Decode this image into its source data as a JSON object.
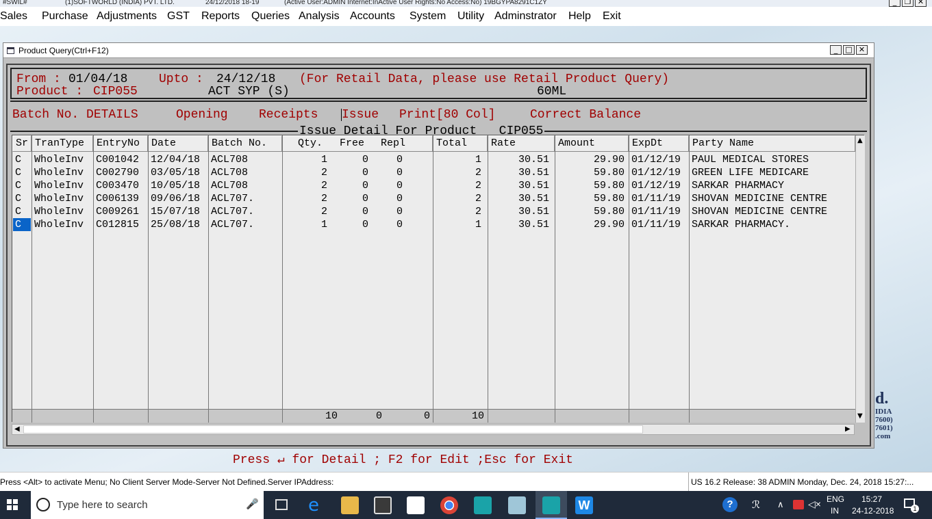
{
  "titlebar": {
    "app": "#SWIL#",
    "company": "(1)SOFTWORLD (INDIA) PVT. LTD.",
    "datetime": "24/12/2018 18-19",
    "status": "(Active User:ADMIN Internet:InActive User Rights:No Access:No) 19BGYPA8291C1ZY"
  },
  "menu": [
    "Sales",
    "Purchase",
    "Adjustments",
    "GST",
    "Reports",
    "Queries",
    "Analysis",
    "Accounts",
    "System",
    "Utility",
    "Adminstrator",
    "Help",
    "Exit"
  ],
  "window": {
    "title": "Product Query(Ctrl+F12)"
  },
  "header": {
    "from_label": "From :",
    "from_value": "01/04/18",
    "upto_label": "Upto :",
    "upto_value": "24/12/18",
    "retail_note": "(For Retail Data, please use Retail Product Query)",
    "product_label": "Product :",
    "product_code": "CIP055",
    "product_name": "ACT SYP (S)",
    "pack": "60ML"
  },
  "options": [
    "Batch No. DETAILS",
    "Opening",
    "Receipts",
    "Issue",
    "Print[80 Col]",
    "Correct Balance"
  ],
  "section_title": "Issue Detail For Product   CIP055",
  "columns": [
    "Sr",
    "TranType",
    "EntryNo",
    "Date",
    "Batch No.",
    "Qty.",
    "Free",
    "Repl",
    "Total",
    "Rate",
    "Amount",
    "ExpDt",
    "Party Name"
  ],
  "rows": [
    {
      "sr": "C",
      "trantype": "WholeInv",
      "entry": "C001042",
      "date": "12/04/18",
      "batch": "ACL708",
      "qty": "1",
      "free": "0",
      "repl": "0",
      "total": "1",
      "rate": "30.51",
      "amount": "29.90",
      "expdt": "01/12/19",
      "party": "PAUL MEDICAL STORES"
    },
    {
      "sr": "C",
      "trantype": "WholeInv",
      "entry": "C002790",
      "date": "03/05/18",
      "batch": "ACL708",
      "qty": "2",
      "free": "0",
      "repl": "0",
      "total": "2",
      "rate": "30.51",
      "amount": "59.80",
      "expdt": "01/12/19",
      "party": "GREEN LIFE MEDICARE"
    },
    {
      "sr": "C",
      "trantype": "WholeInv",
      "entry": "C003470",
      "date": "10/05/18",
      "batch": "ACL708",
      "qty": "2",
      "free": "0",
      "repl": "0",
      "total": "2",
      "rate": "30.51",
      "amount": "59.80",
      "expdt": "01/12/19",
      "party": "SARKAR PHARMACY"
    },
    {
      "sr": "C",
      "trantype": "WholeInv",
      "entry": "C006139",
      "date": "09/06/18",
      "batch": "ACL707.",
      "qty": "2",
      "free": "0",
      "repl": "0",
      "total": "2",
      "rate": "30.51",
      "amount": "59.80",
      "expdt": "01/11/19",
      "party": "SHOVAN MEDICINE CENTRE"
    },
    {
      "sr": "C",
      "trantype": "WholeInv",
      "entry": "C009261",
      "date": "15/07/18",
      "batch": "ACL707.",
      "qty": "2",
      "free": "0",
      "repl": "0",
      "total": "2",
      "rate": "30.51",
      "amount": "59.80",
      "expdt": "01/11/19",
      "party": "SHOVAN MEDICINE CENTRE"
    },
    {
      "sr": "C",
      "trantype": "WholeInv",
      "entry": "C012815",
      "date": "25/08/18",
      "batch": "ACL707.",
      "qty": "1",
      "free": "0",
      "repl": "0",
      "total": "1",
      "rate": "30.51",
      "amount": "29.90",
      "expdt": "01/11/19",
      "party": "SARKAR PHARMACY."
    }
  ],
  "totals": {
    "qty": "10",
    "free": "0",
    "repl": "0",
    "total": "10"
  },
  "press_line": "Press ↵ for Detail ; F2 for Edit ;Esc for Exit",
  "statusbar": {
    "left": "Press <Alt> to activate Menu; No Client Server Mode-Server Not Defined.Server IPAddress:",
    "right": "US 16.2 Release: 38  ADMIN  Monday, Dec. 24, 2018  15:27:..."
  },
  "brand_lines": [
    "d.",
    "IDIA",
    "7600)",
    "7601)",
    ".com"
  ],
  "taskbar": {
    "search_placeholder": "Type here to search",
    "lang_top": "ENG",
    "lang_bottom": "IN",
    "time": "15:27",
    "date": "24-12-2018",
    "notification_count": "1"
  }
}
